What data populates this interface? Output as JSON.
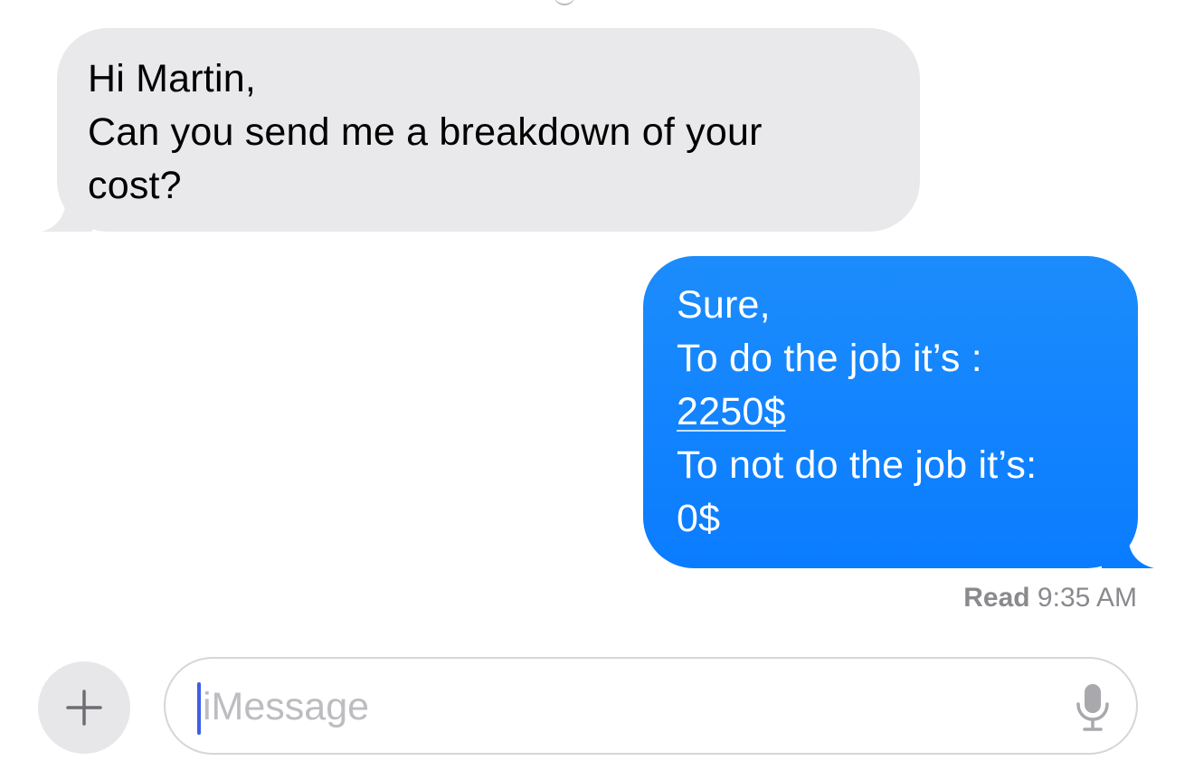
{
  "conversation": {
    "incoming": {
      "lines": [
        "Hi Martin,",
        "Can you send me a breakdown of your",
        "cost?"
      ]
    },
    "outgoing": {
      "line1": "Sure,",
      "line2": "To do the job it’s :",
      "price_link": "2250$",
      "line4": "To not do the job it’s:",
      "line5": "0$"
    },
    "receipt": {
      "status": "Read",
      "time": "9:35 AM"
    }
  },
  "composer": {
    "add_icon": "plus-icon",
    "placeholder": "iMessage",
    "mic_icon": "microphone-icon"
  },
  "colors": {
    "incoming_bubble": "#e9e9eb",
    "outgoing_bubble": "#0a7cff",
    "caret": "#3d5ee8",
    "receipt_text": "#8a8a8e"
  }
}
